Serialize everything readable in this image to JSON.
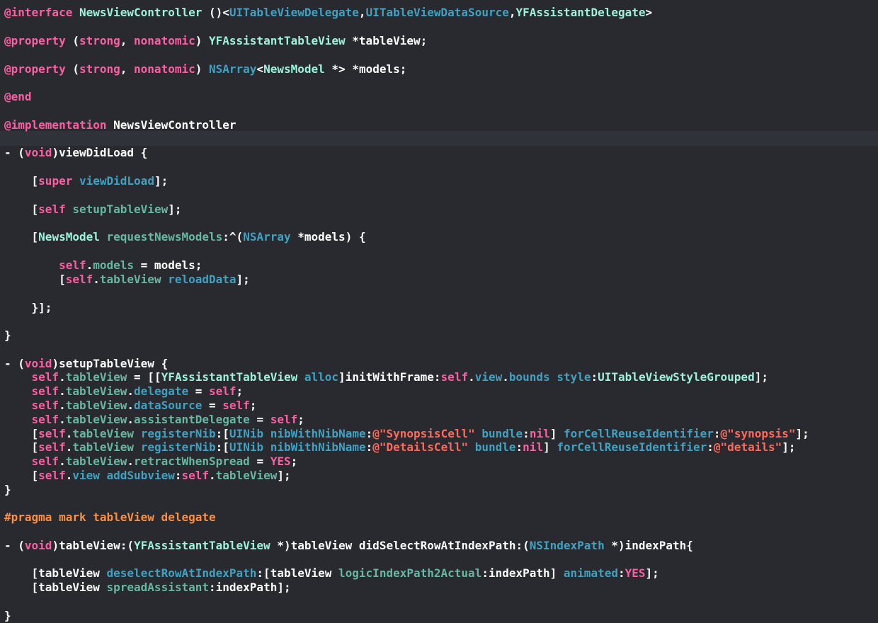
{
  "editor": {
    "highlighted_line": 5,
    "colors": {
      "background": "#292a30",
      "current_line": "#2f3239",
      "plain": "#ffffff",
      "keyword": "#fc5fa3",
      "preprocessor": "#fd8f3f",
      "project_type": "#9ef1dd",
      "project_member": "#67b7a4",
      "system_member": "#41a1c0",
      "string": "#fc6a5d"
    },
    "lines": [
      {
        "tokens": [
          {
            "t": "@interface ",
            "k": "kw"
          },
          {
            "t": "NewsViewController",
            "k": "type"
          },
          {
            "t": " ()<",
            "k": "plain"
          },
          {
            "t": "UITableViewDelegate",
            "k": "sys"
          },
          {
            "t": ",",
            "k": "plain"
          },
          {
            "t": "UITableViewDataSource",
            "k": "sys"
          },
          {
            "t": ",",
            "k": "plain"
          },
          {
            "t": "YFAssistantDelegate",
            "k": "type"
          },
          {
            "t": ">",
            "k": "plain"
          }
        ]
      },
      {
        "tokens": [
          {
            "t": "@property",
            "k": "kw"
          },
          {
            "t": " (",
            "k": "plain"
          },
          {
            "t": "strong",
            "k": "kw"
          },
          {
            "t": ", ",
            "k": "plain"
          },
          {
            "t": "nonatomic",
            "k": "kw"
          },
          {
            "t": ") ",
            "k": "plain"
          },
          {
            "t": "YFAssistantTableView",
            "k": "type"
          },
          {
            "t": " *tableView;",
            "k": "plain"
          }
        ]
      },
      {
        "tokens": [
          {
            "t": "@property",
            "k": "kw"
          },
          {
            "t": " (",
            "k": "plain"
          },
          {
            "t": "strong",
            "k": "kw"
          },
          {
            "t": ", ",
            "k": "plain"
          },
          {
            "t": "nonatomic",
            "k": "kw"
          },
          {
            "t": ") ",
            "k": "plain"
          },
          {
            "t": "NSArray",
            "k": "sys"
          },
          {
            "t": "<",
            "k": "plain"
          },
          {
            "t": "NewsModel",
            "k": "type"
          },
          {
            "t": " *> *models;",
            "k": "plain"
          }
        ]
      },
      {
        "tokens": [
          {
            "t": "@end",
            "k": "kw"
          }
        ]
      },
      {
        "tokens": [
          {
            "t": "@implementation",
            "k": "kw"
          },
          {
            "t": " NewsViewController",
            "k": "plain"
          }
        ]
      },
      {
        "tokens": [
          {
            "t": "- (",
            "k": "plain"
          },
          {
            "t": "void",
            "k": "kw"
          },
          {
            "t": ")viewDidLoad {",
            "k": "plain"
          }
        ]
      },
      {
        "tokens": [
          {
            "t": "    [",
            "k": "plain"
          },
          {
            "t": "super",
            "k": "kw"
          },
          {
            "t": " ",
            "k": "plain"
          },
          {
            "t": "viewDidLoad",
            "k": "sys"
          },
          {
            "t": "];",
            "k": "plain"
          }
        ]
      },
      {
        "tokens": [
          {
            "t": "    [",
            "k": "plain"
          },
          {
            "t": "self",
            "k": "kw"
          },
          {
            "t": " ",
            "k": "plain"
          },
          {
            "t": "setupTableView",
            "k": "proj"
          },
          {
            "t": "];",
            "k": "plain"
          }
        ]
      },
      {
        "tokens": [
          {
            "t": "    [",
            "k": "plain"
          },
          {
            "t": "NewsModel",
            "k": "type"
          },
          {
            "t": " ",
            "k": "plain"
          },
          {
            "t": "requestNewsModels",
            "k": "proj"
          },
          {
            "t": ":^(",
            "k": "plain"
          },
          {
            "t": "NSArray",
            "k": "sys"
          },
          {
            "t": " *models) {",
            "k": "plain"
          }
        ]
      },
      {
        "tokens": [
          {
            "t": "        ",
            "k": "plain"
          },
          {
            "t": "self",
            "k": "kw"
          },
          {
            "t": ".",
            "k": "plain"
          },
          {
            "t": "models",
            "k": "proj"
          },
          {
            "t": " = models;",
            "k": "plain"
          }
        ]
      },
      {
        "tokens": [
          {
            "t": "        [",
            "k": "plain"
          },
          {
            "t": "self",
            "k": "kw"
          },
          {
            "t": ".",
            "k": "plain"
          },
          {
            "t": "tableView",
            "k": "proj"
          },
          {
            "t": " ",
            "k": "plain"
          },
          {
            "t": "reloadData",
            "k": "sys"
          },
          {
            "t": "];",
            "k": "plain"
          }
        ]
      },
      {
        "tokens": [
          {
            "t": "    }];",
            "k": "plain"
          }
        ]
      },
      {
        "tokens": [
          {
            "t": "}",
            "k": "plain"
          }
        ]
      },
      {
        "tokens": [
          {
            "t": "- (",
            "k": "plain"
          },
          {
            "t": "void",
            "k": "kw"
          },
          {
            "t": ")setupTableView {",
            "k": "plain"
          }
        ]
      },
      {
        "tokens": [
          {
            "t": "    ",
            "k": "plain"
          },
          {
            "t": "self",
            "k": "kw"
          },
          {
            "t": ".",
            "k": "plain"
          },
          {
            "t": "tableView",
            "k": "proj"
          },
          {
            "t": " = [[",
            "k": "plain"
          },
          {
            "t": "YFAssistantTableView",
            "k": "type"
          },
          {
            "t": " ",
            "k": "plain"
          },
          {
            "t": "alloc",
            "k": "sys"
          },
          {
            "t": "]initWithFrame:",
            "k": "plain"
          },
          {
            "t": "self",
            "k": "kw"
          },
          {
            "t": ".",
            "k": "plain"
          },
          {
            "t": "view",
            "k": "sys"
          },
          {
            "t": ".",
            "k": "plain"
          },
          {
            "t": "bounds",
            "k": "sys"
          },
          {
            "t": " ",
            "k": "plain"
          },
          {
            "t": "style",
            "k": "sys"
          },
          {
            "t": ":",
            "k": "plain"
          },
          {
            "t": "UITableViewStyleGrouped",
            "k": "type"
          },
          {
            "t": "];",
            "k": "plain"
          }
        ]
      },
      {
        "tokens": [
          {
            "t": "    ",
            "k": "plain"
          },
          {
            "t": "self",
            "k": "kw"
          },
          {
            "t": ".",
            "k": "plain"
          },
          {
            "t": "tableView",
            "k": "proj"
          },
          {
            "t": ".",
            "k": "plain"
          },
          {
            "t": "delegate",
            "k": "sys"
          },
          {
            "t": " = ",
            "k": "plain"
          },
          {
            "t": "self",
            "k": "kw"
          },
          {
            "t": ";",
            "k": "plain"
          }
        ]
      },
      {
        "tokens": [
          {
            "t": "    ",
            "k": "plain"
          },
          {
            "t": "self",
            "k": "kw"
          },
          {
            "t": ".",
            "k": "plain"
          },
          {
            "t": "tableView",
            "k": "proj"
          },
          {
            "t": ".",
            "k": "plain"
          },
          {
            "t": "dataSource",
            "k": "sys"
          },
          {
            "t": " = ",
            "k": "plain"
          },
          {
            "t": "self",
            "k": "kw"
          },
          {
            "t": ";",
            "k": "plain"
          }
        ]
      },
      {
        "tokens": [
          {
            "t": "    ",
            "k": "plain"
          },
          {
            "t": "self",
            "k": "kw"
          },
          {
            "t": ".",
            "k": "plain"
          },
          {
            "t": "tableView",
            "k": "proj"
          },
          {
            "t": ".",
            "k": "plain"
          },
          {
            "t": "assistantDelegate",
            "k": "proj"
          },
          {
            "t": " = ",
            "k": "plain"
          },
          {
            "t": "self",
            "k": "kw"
          },
          {
            "t": ";",
            "k": "plain"
          }
        ]
      },
      {
        "tokens": [
          {
            "t": "    [",
            "k": "plain"
          },
          {
            "t": "self",
            "k": "kw"
          },
          {
            "t": ".",
            "k": "plain"
          },
          {
            "t": "tableView",
            "k": "proj"
          },
          {
            "t": " ",
            "k": "plain"
          },
          {
            "t": "registerNib",
            "k": "sys"
          },
          {
            "t": ":[",
            "k": "plain"
          },
          {
            "t": "UINib",
            "k": "sys"
          },
          {
            "t": " ",
            "k": "plain"
          },
          {
            "t": "nibWithNibName",
            "k": "sys"
          },
          {
            "t": ":",
            "k": "plain"
          },
          {
            "t": "@\"SynopsisCell\"",
            "k": "str"
          },
          {
            "t": " ",
            "k": "plain"
          },
          {
            "t": "bundle",
            "k": "sys"
          },
          {
            "t": ":",
            "k": "plain"
          },
          {
            "t": "nil",
            "k": "kw"
          },
          {
            "t": "] ",
            "k": "plain"
          },
          {
            "t": "forCellReuseIdentifier",
            "k": "sys"
          },
          {
            "t": ":",
            "k": "plain"
          },
          {
            "t": "@\"synopsis\"",
            "k": "str"
          },
          {
            "t": "];",
            "k": "plain"
          }
        ]
      },
      {
        "tokens": [
          {
            "t": "    [",
            "k": "plain"
          },
          {
            "t": "self",
            "k": "kw"
          },
          {
            "t": ".",
            "k": "plain"
          },
          {
            "t": "tableView",
            "k": "proj"
          },
          {
            "t": " ",
            "k": "plain"
          },
          {
            "t": "registerNib",
            "k": "sys"
          },
          {
            "t": ":[",
            "k": "plain"
          },
          {
            "t": "UINib",
            "k": "sys"
          },
          {
            "t": " ",
            "k": "plain"
          },
          {
            "t": "nibWithNibName",
            "k": "sys"
          },
          {
            "t": ":",
            "k": "plain"
          },
          {
            "t": "@\"DetailsCell\"",
            "k": "str"
          },
          {
            "t": " ",
            "k": "plain"
          },
          {
            "t": "bundle",
            "k": "sys"
          },
          {
            "t": ":",
            "k": "plain"
          },
          {
            "t": "nil",
            "k": "kw"
          },
          {
            "t": "] ",
            "k": "plain"
          },
          {
            "t": "forCellReuseIdentifier",
            "k": "sys"
          },
          {
            "t": ":",
            "k": "plain"
          },
          {
            "t": "@\"details\"",
            "k": "str"
          },
          {
            "t": "];",
            "k": "plain"
          }
        ]
      },
      {
        "tokens": [
          {
            "t": "    ",
            "k": "plain"
          },
          {
            "t": "self",
            "k": "kw"
          },
          {
            "t": ".",
            "k": "plain"
          },
          {
            "t": "tableView",
            "k": "proj"
          },
          {
            "t": ".",
            "k": "plain"
          },
          {
            "t": "retractWhenSpread",
            "k": "proj"
          },
          {
            "t": " = ",
            "k": "plain"
          },
          {
            "t": "YES",
            "k": "kw"
          },
          {
            "t": ";",
            "k": "plain"
          }
        ]
      },
      {
        "tokens": [
          {
            "t": "    [",
            "k": "plain"
          },
          {
            "t": "self",
            "k": "kw"
          },
          {
            "t": ".",
            "k": "plain"
          },
          {
            "t": "view",
            "k": "sys"
          },
          {
            "t": " ",
            "k": "plain"
          },
          {
            "t": "addSubview",
            "k": "sys"
          },
          {
            "t": ":",
            "k": "plain"
          },
          {
            "t": "self",
            "k": "kw"
          },
          {
            "t": ".",
            "k": "plain"
          },
          {
            "t": "tableView",
            "k": "proj"
          },
          {
            "t": "];",
            "k": "plain"
          }
        ]
      },
      {
        "tokens": [
          {
            "t": "}",
            "k": "plain"
          }
        ]
      },
      {
        "tokens": [
          {
            "t": "#pragma mark tableView delegate",
            "k": "pre"
          }
        ]
      },
      {
        "tokens": [
          {
            "t": "- (",
            "k": "plain"
          },
          {
            "t": "void",
            "k": "kw"
          },
          {
            "t": ")tableView:(",
            "k": "plain"
          },
          {
            "t": "YFAssistantTableView",
            "k": "type"
          },
          {
            "t": " *)tableView didSelectRowAtIndexPath:(",
            "k": "plain"
          },
          {
            "t": "NSIndexPath",
            "k": "sys"
          },
          {
            "t": " *)indexPath{",
            "k": "plain"
          }
        ]
      },
      {
        "tokens": [
          {
            "t": "    [tableView ",
            "k": "plain"
          },
          {
            "t": "deselectRowAtIndexPath",
            "k": "sys"
          },
          {
            "t": ":[tableView ",
            "k": "plain"
          },
          {
            "t": "logicIndexPath2Actual",
            "k": "proj"
          },
          {
            "t": ":indexPath] ",
            "k": "plain"
          },
          {
            "t": "animated",
            "k": "sys"
          },
          {
            "t": ":",
            "k": "plain"
          },
          {
            "t": "YES",
            "k": "kw"
          },
          {
            "t": "];",
            "k": "plain"
          }
        ]
      },
      {
        "tokens": [
          {
            "t": "    [tableView ",
            "k": "plain"
          },
          {
            "t": "spreadAssistant",
            "k": "proj"
          },
          {
            "t": ":indexPath];",
            "k": "plain"
          }
        ]
      },
      {
        "tokens": [
          {
            "t": "}",
            "k": "plain"
          }
        ]
      }
    ]
  }
}
